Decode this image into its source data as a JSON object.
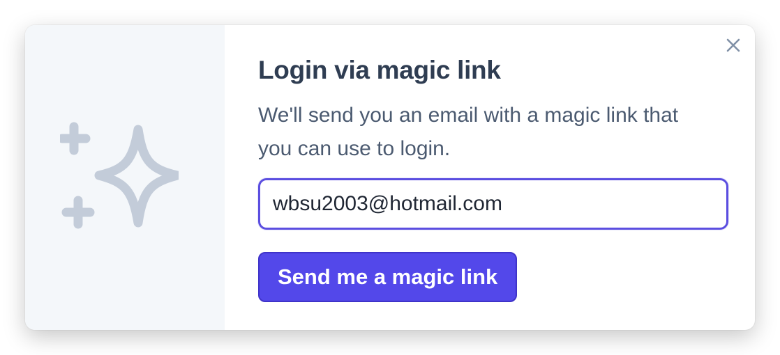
{
  "dialog": {
    "title": "Login via magic link",
    "description": "We'll send you an email with a magic link that you can use to login.",
    "email_value": "wbsu2003@hotmail.com",
    "email_placeholder": "",
    "submit_label": "Send me a magic link",
    "close_icon": "close-icon",
    "illustration_icon": "sparkles-icon"
  },
  "colors": {
    "accent": "#5348ea",
    "focus_ring": "#5b4ee0",
    "title": "#2f3d52",
    "body_text": "#4b5a70",
    "illustration": "#c3ccd9",
    "side_panel": "#f4f7fa"
  }
}
